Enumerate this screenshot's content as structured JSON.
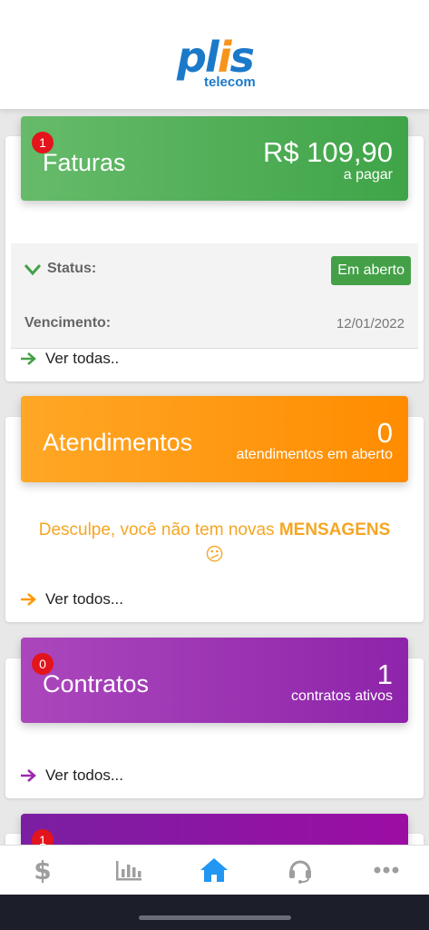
{
  "brand": {
    "name_a": "pl",
    "name_i": "i",
    "name_b": "s",
    "sub": "telecom",
    "blue": "#1b79c9",
    "orange": "#f7941d"
  },
  "faturas": {
    "badge": "1",
    "title": "Faturas",
    "amount": "R$ 109,90",
    "amount_caption": "a pagar",
    "status_label": "Status:",
    "status_value": "Em aberto",
    "due_label": "Vencimento:",
    "due_value": "12/01/2022",
    "link": "Ver todas..",
    "color": "#4caf50"
  },
  "atendimentos": {
    "title": "Atendimentos",
    "count": "0",
    "count_caption": "atendimentos em aberto",
    "empty_prefix": "Desculpe, você não tem novas",
    "empty_bold": "MENSAGENS",
    "empty_emoji": "😕",
    "link": "Ver todos...",
    "color": "#ff9800"
  },
  "contratos": {
    "badge": "0",
    "title": "Contratos",
    "count": "1",
    "count_caption": "contratos ativos",
    "link": "Ver todos...",
    "color": "#9c27b0"
  },
  "next_card": {
    "badge": "1"
  },
  "tabbar": {
    "tabs": [
      {
        "icon": "dollar-icon",
        "active": false
      },
      {
        "icon": "chart-icon",
        "active": false
      },
      {
        "icon": "home-icon",
        "active": true
      },
      {
        "icon": "headset-icon",
        "active": false
      },
      {
        "icon": "more-icon",
        "active": false
      }
    ],
    "active_color": "#2196f3",
    "inactive_color": "#9e9e9e"
  }
}
